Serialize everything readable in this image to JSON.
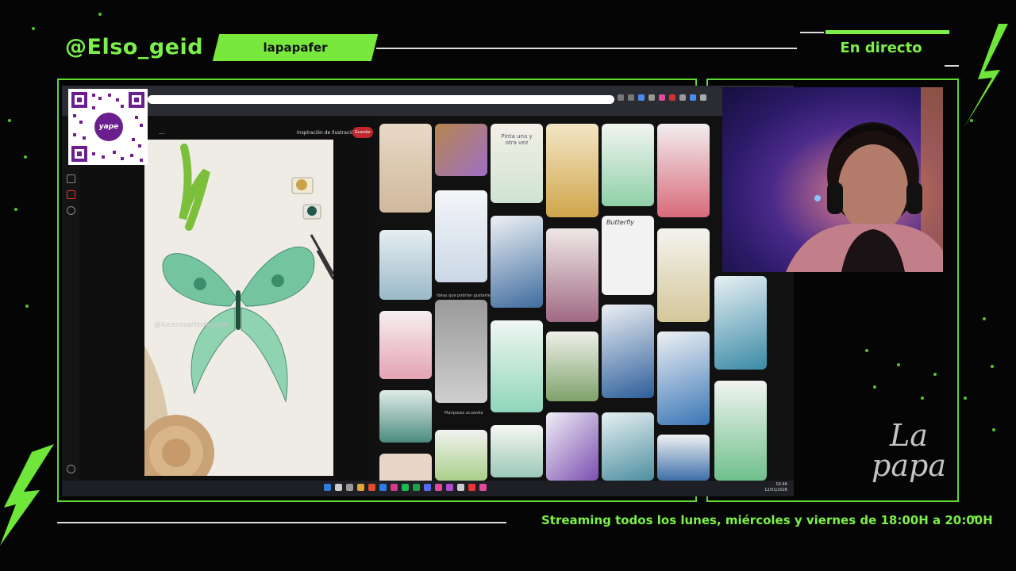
{
  "overlay": {
    "handle": "@Elso_geid",
    "channel": "lapapafer",
    "live_status": "En directo",
    "schedule": "Streaming todos los lunes, miércoles y viernes de 18:00H a 20:00H",
    "qr_brand": "yape",
    "logo_line1": "La",
    "logo_line2": "papa",
    "accent_color": "#7cf04a"
  },
  "screen": {
    "board_label": "Inspiración de Ilustración",
    "save_label": "Guardar",
    "more_label": "...",
    "pin_watermark": "@lucerosartedeguxo",
    "clock_time": "02:46",
    "clock_date": "12/01/2026",
    "grid_captions": {
      "c1": "Ideas que podrían gustarte",
      "c2": "Mariposas acuarela"
    },
    "tile_text": {
      "pinta": "Pinta una y otra vez",
      "butterfly": "Butterfly"
    },
    "left_rail_icons": [
      "plus-icon",
      "bell-icon",
      "message-icon",
      "settings-icon"
    ]
  }
}
